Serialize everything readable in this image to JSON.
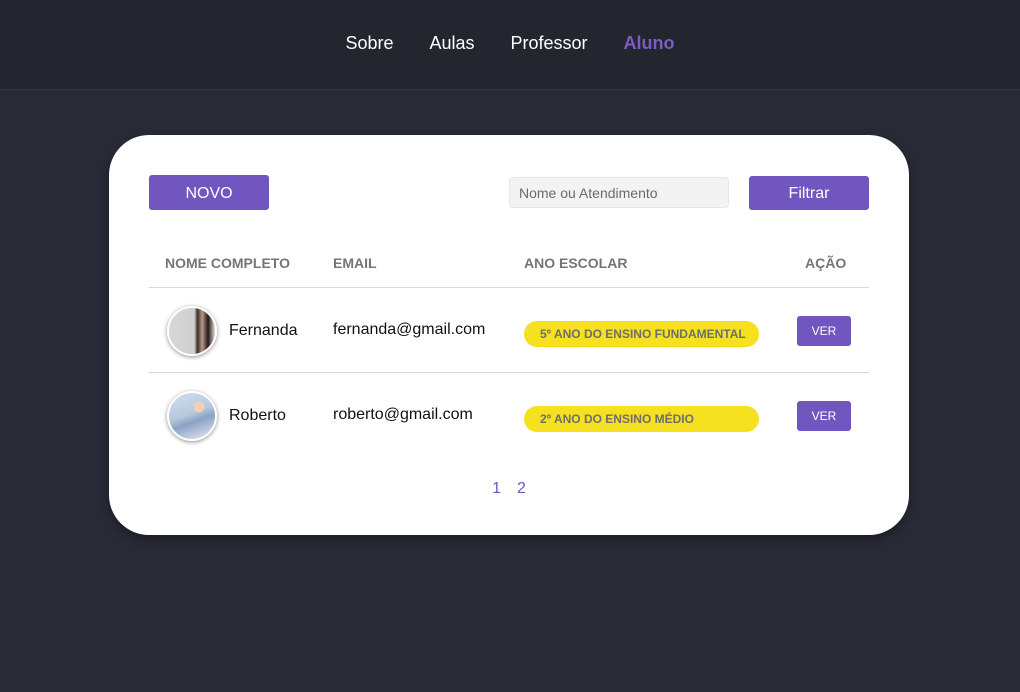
{
  "nav": {
    "items": [
      {
        "label": "Sobre"
      },
      {
        "label": "Aulas"
      },
      {
        "label": "Professor"
      },
      {
        "label": "Aluno"
      }
    ]
  },
  "toolbar": {
    "new_label": "NOVO",
    "search_placeholder": "Nome ou Atendimento",
    "search_value": "",
    "filter_label": "Filtrar"
  },
  "table": {
    "headers": [
      "NOME COMPLETO",
      "EMAIL",
      "ANO ESCOLAR",
      "AÇÃO"
    ],
    "rows": [
      {
        "name": "Fernanda",
        "email": "fernanda@gmail.com",
        "grade": "5º ANO DO ENSINO FUNDAMENTAL",
        "action": "VER"
      },
      {
        "name": "Roberto",
        "email": "roberto@gmail.com",
        "grade": "2º ANO DO ENSINO MÉDIO",
        "action": "VER"
      }
    ]
  },
  "pagination": {
    "pages": [
      "1",
      "2"
    ]
  },
  "colors": {
    "accent": "#7156c0",
    "badge": "#f5e11f",
    "background": "#282a36"
  }
}
